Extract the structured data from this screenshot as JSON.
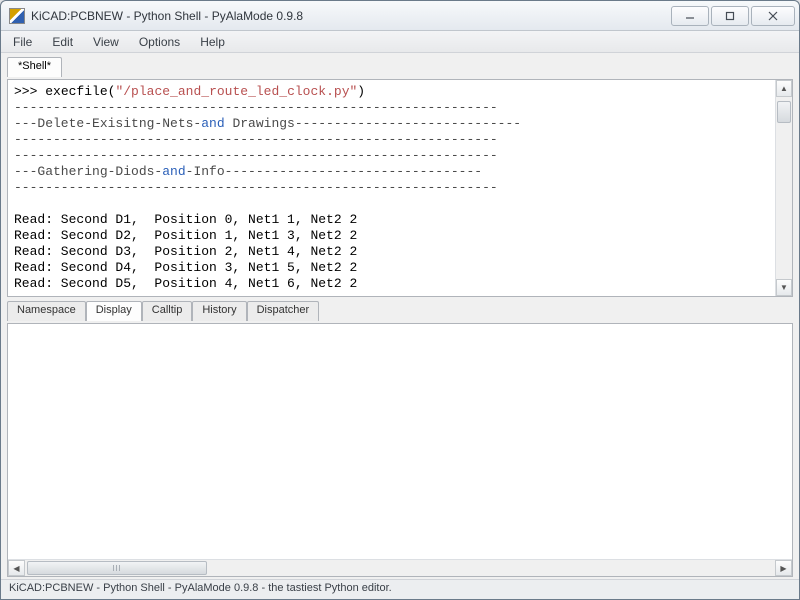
{
  "window": {
    "title": "KiCAD:PCBNEW - Python Shell - PyAlaMode 0.9.8"
  },
  "menu": [
    "File",
    "Edit",
    "View",
    "Options",
    "Help"
  ],
  "shell_tab": "*Shell*",
  "console": {
    "prompt": ">>> ",
    "cmd_fn": "execfile",
    "cmd_open": "(",
    "cmd_str": "\"/place_and_route_led_clock.py\"",
    "cmd_close": ")",
    "dashline": "--------------------------------------------------------------",
    "hdr1_a": "---Delete-Exisitng-Nets-",
    "hdr1_kw": "and",
    "hdr1_b": " Drawings-----------------------------",
    "hdr2_a": "---Gathering-Diods-",
    "hdr2_kw": "and",
    "hdr2_b": "-Info---------------------------------",
    "reads": [
      "Read: Second D1,  Position 0, Net1 1, Net2 2",
      "Read: Second D2,  Position 1, Net1 3, Net2 2",
      "Read: Second D3,  Position 2, Net1 4, Net2 2",
      "Read: Second D4,  Position 3, Net1 5, Net2 2",
      "Read: Second D5,  Position 4, Net1 6, Net2 2"
    ]
  },
  "tabs": [
    "Namespace",
    "Display",
    "Calltip",
    "History",
    "Dispatcher"
  ],
  "active_tab": 1,
  "status": "KiCAD:PCBNEW - Python Shell - PyAlaMode 0.9.8 - the tastiest Python editor."
}
